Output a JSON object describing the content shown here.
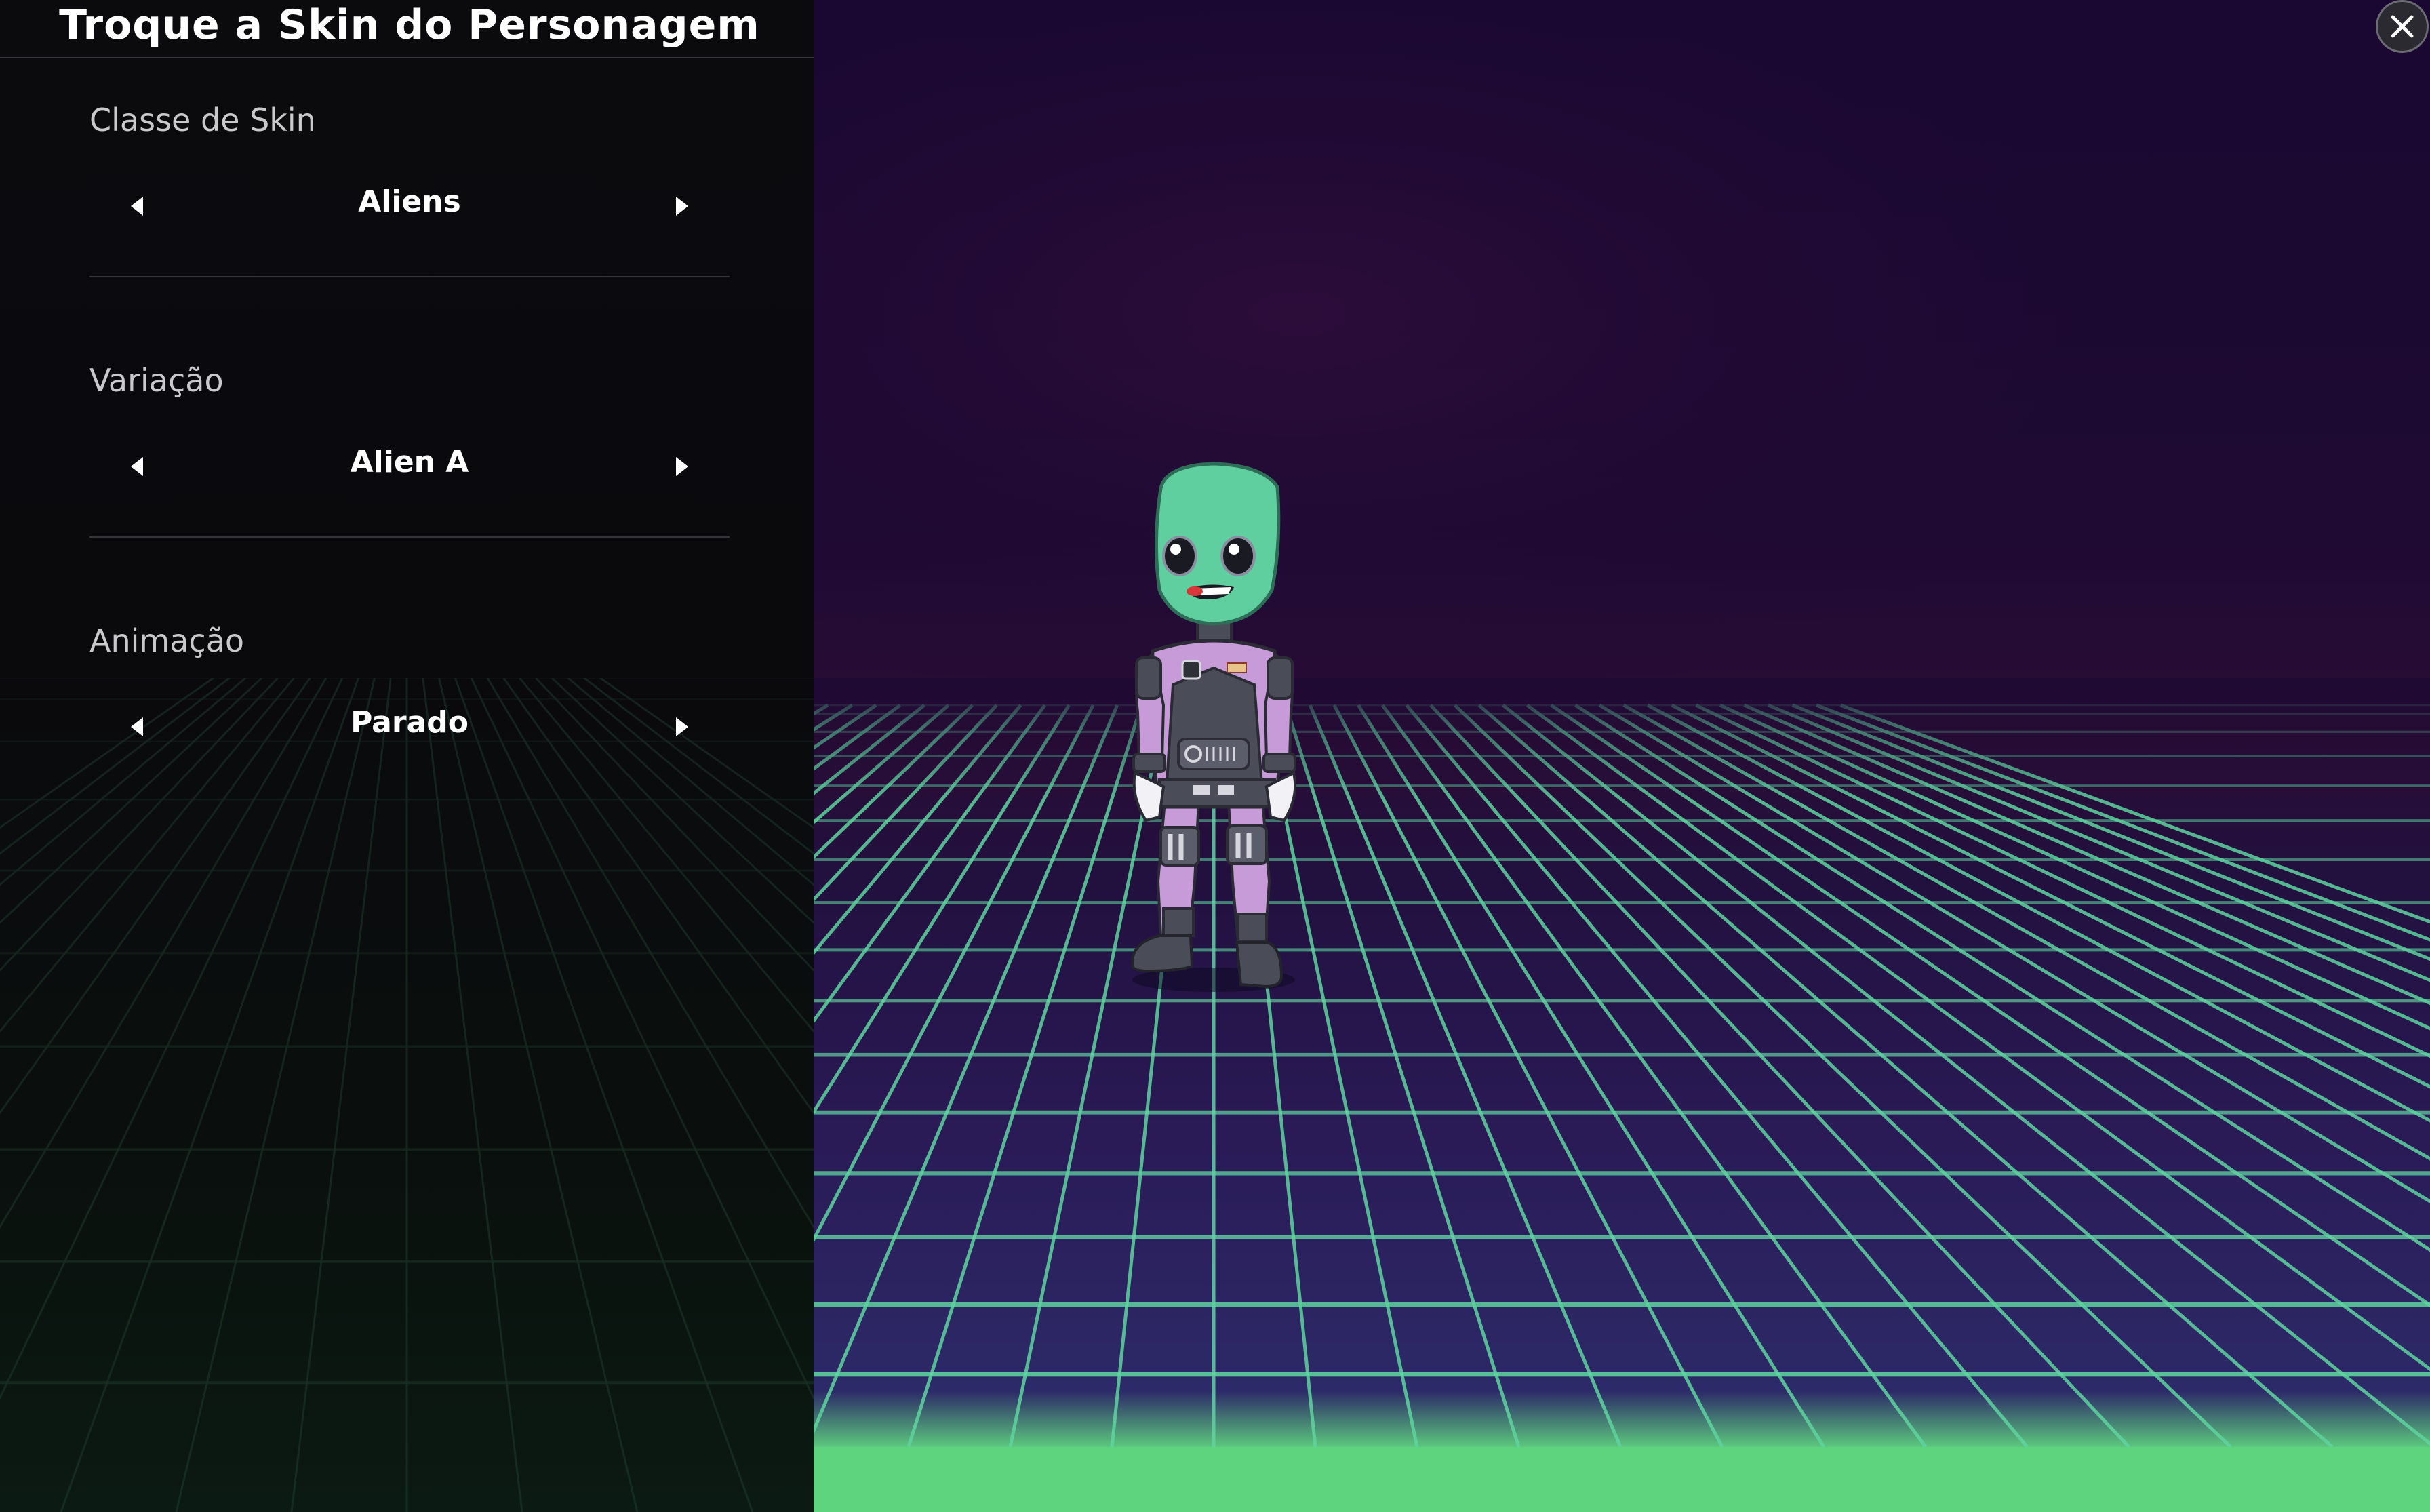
{
  "panel": {
    "title": "Troque a Skin do Personagem",
    "options": [
      {
        "label": "Classe de Skin",
        "value": "Aliens"
      },
      {
        "label": "Variação",
        "value": "Alien A"
      },
      {
        "label": "Animação",
        "value": "Parado"
      }
    ]
  },
  "icons": {
    "prev": "caret-left-icon",
    "next": "caret-right-icon",
    "close": "close-icon"
  },
  "colors": {
    "panel_bg": "#0b0b0e",
    "scene_sky": "#1a0832",
    "grid_line": "#5fd4a0",
    "floor_glow": "#5fd47f",
    "alien_skin": "#5fcf9f",
    "suit_purple": "#c79ad8",
    "suit_gray": "#4a4d58"
  }
}
